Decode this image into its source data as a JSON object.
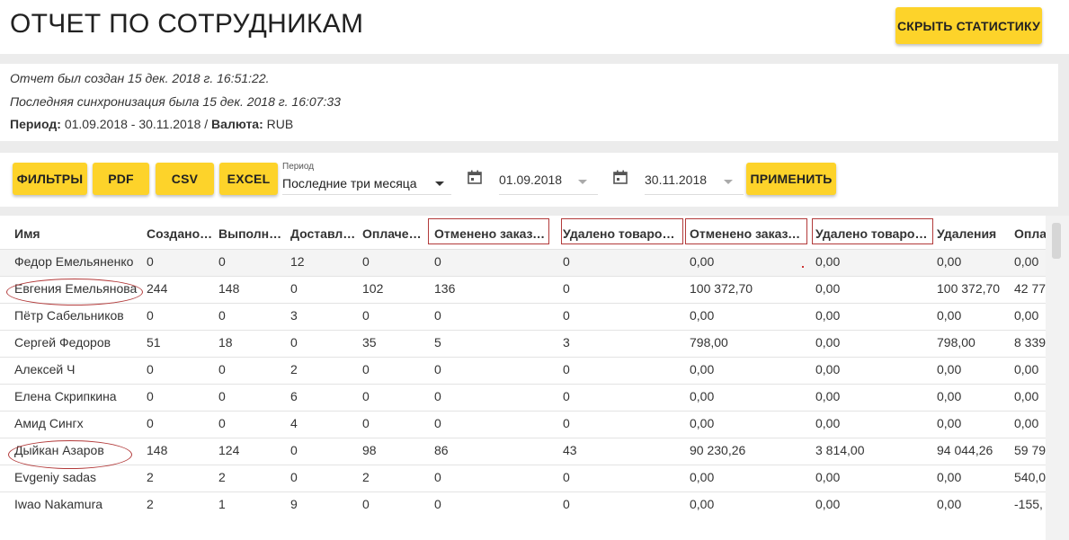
{
  "header": {
    "title": "ОТЧЕТ ПО СОТРУДНИКАМ",
    "hide_stats_label": "СКРЫТЬ СТАТИСТИКУ"
  },
  "info": {
    "created": "Отчет был создан 15 дек. 2018 г. 16:51:22.",
    "synced": "Последняя синхронизация была 15 дек. 2018 г. 16:07:33",
    "period_label": "Период:",
    "period_value": " 01.09.2018 - 30.11.2018 / ",
    "currency_label": "Валюта:",
    "currency_value": " RUB"
  },
  "toolbar": {
    "filters": "ФИЛЬТРЫ",
    "pdf": "PDF",
    "csv": "CSV",
    "excel": "EXCEL",
    "period_caption": "Период",
    "period_value": "Последние три месяца",
    "date_from": "01.09.2018",
    "date_to": "30.11.2018",
    "apply": "ПРИМЕНИТЬ"
  },
  "table": {
    "columns": [
      "Имя",
      "Создано…",
      "Выполн…",
      "Доставл…",
      "Оплачен…",
      "Отменено заказов",
      "Удалено товаров …",
      "Отменено заказо…",
      "Удалено товаров…",
      "Удаления",
      "Опла"
    ],
    "rows": [
      [
        "Федор Емельяненко",
        "0",
        "0",
        "12",
        "0",
        "0",
        "0",
        "0,00",
        "0,00",
        "0,00",
        "0,00"
      ],
      [
        "Евгения Емельянова",
        "244",
        "148",
        "0",
        "102",
        "136",
        "0",
        "100 372,70",
        "0,00",
        "100 372,70",
        "42 77"
      ],
      [
        "Пётр Сабельников",
        "0",
        "0",
        "3",
        "0",
        "0",
        "0",
        "0,00",
        "0,00",
        "0,00",
        "0,00"
      ],
      [
        "Сергей Федоров",
        "51",
        "18",
        "0",
        "35",
        "5",
        "3",
        "798,00",
        "0,00",
        "798,00",
        "8 339"
      ],
      [
        "Алексей Ч",
        "0",
        "0",
        "2",
        "0",
        "0",
        "0",
        "0,00",
        "0,00",
        "0,00",
        "0,00"
      ],
      [
        "Елена Скрипкина",
        "0",
        "0",
        "6",
        "0",
        "0",
        "0",
        "0,00",
        "0,00",
        "0,00",
        "0,00"
      ],
      [
        "Амид Сингх",
        "0",
        "0",
        "4",
        "0",
        "0",
        "0",
        "0,00",
        "0,00",
        "0,00",
        "0,00"
      ],
      [
        "Дыйкан Азаров",
        "148",
        "124",
        "0",
        "98",
        "86",
        "43",
        "90 230,26",
        "3 814,00",
        "94 044,26",
        "59 79"
      ],
      [
        "Evgeniy sadas",
        "2",
        "2",
        "0",
        "2",
        "0",
        "0",
        "0,00",
        "0,00",
        "0,00",
        "540,0"
      ],
      [
        "Iwao Nakamura",
        "2",
        "1",
        "9",
        "0",
        "0",
        "0",
        "0,00",
        "0,00",
        "0,00",
        "-155,"
      ]
    ]
  },
  "colors": {
    "accent": "#fdd32a",
    "annotation": "#b23a3a"
  }
}
